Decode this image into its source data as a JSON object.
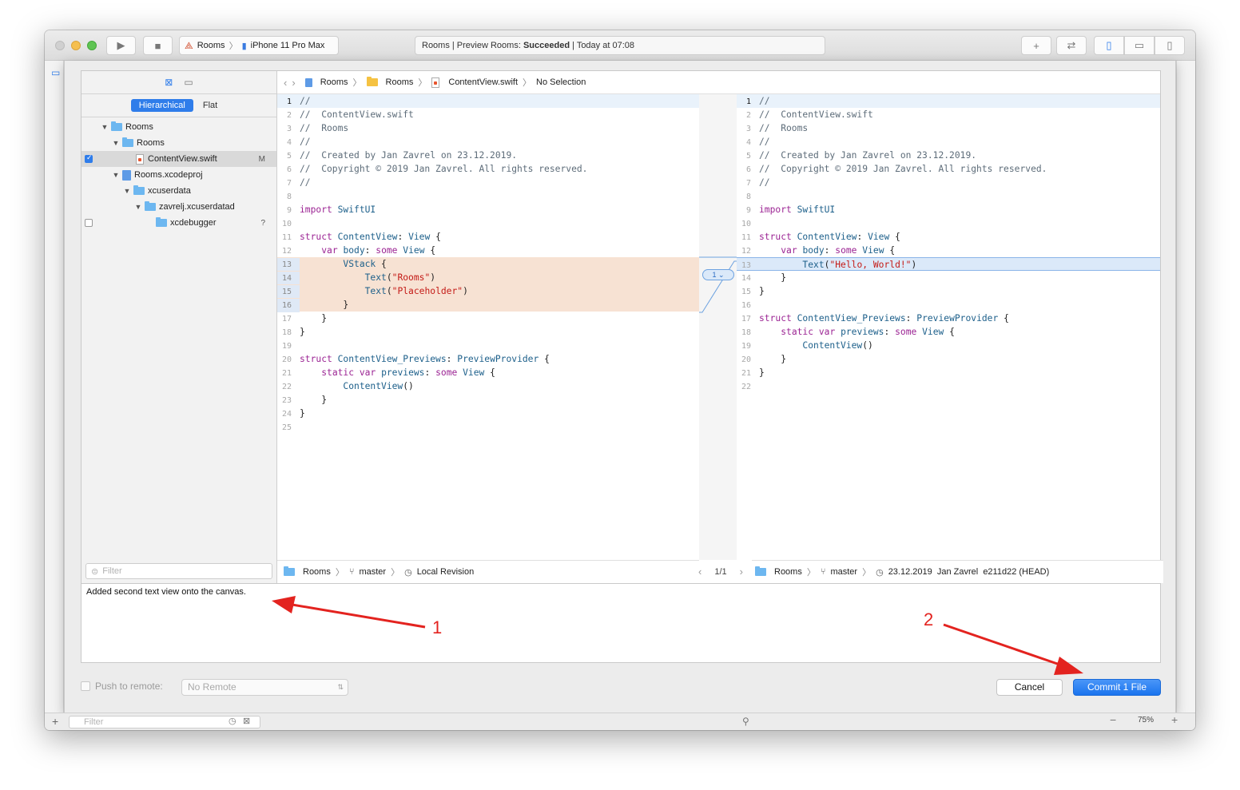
{
  "toolbar": {
    "scheme_project": "Rooms",
    "scheme_device": "iPhone 11 Pro Max",
    "status_prefix": "Rooms | Preview Rooms: ",
    "status_result": "Succeeded",
    "status_suffix": " | Today at 07:08"
  },
  "navigator": {
    "mode_hierarchical": "Hierarchical",
    "mode_flat": "Flat",
    "tree": [
      {
        "label": "Rooms",
        "type": "project",
        "checked": null,
        "flag": ""
      },
      {
        "label": "Rooms",
        "type": "folder",
        "checked": null,
        "flag": ""
      },
      {
        "label": "ContentView.swift",
        "type": "file",
        "checked": true,
        "flag": "M"
      },
      {
        "label": "Rooms.xcodeproj",
        "type": "project",
        "checked": null,
        "flag": ""
      },
      {
        "label": "xcuserdata",
        "type": "folder",
        "checked": null,
        "flag": ""
      },
      {
        "label": "zavrelj.xcuserdatad",
        "type": "folder",
        "checked": null,
        "flag": ""
      },
      {
        "label": "xcdebugger",
        "type": "folder",
        "checked": false,
        "flag": "?"
      }
    ],
    "filter_placeholder": "Filter"
  },
  "jumpbar": {
    "crumbs": [
      "Rooms",
      "Rooms",
      "ContentView.swift",
      "No Selection"
    ]
  },
  "left_code": [
    {
      "n": "1",
      "text": "//"
    },
    {
      "n": "2",
      "text": "//  ContentView.swift"
    },
    {
      "n": "3",
      "text": "//  Rooms"
    },
    {
      "n": "4",
      "text": "//"
    },
    {
      "n": "5",
      "text": "//  Created by Jan Zavrel on 23.12.2019."
    },
    {
      "n": "6",
      "text": "//  Copyright © 2019 Jan Zavrel. All rights reserved."
    },
    {
      "n": "7",
      "text": "//"
    },
    {
      "n": "8",
      "text": ""
    },
    {
      "n": "9",
      "text": "import SwiftUI"
    },
    {
      "n": "10",
      "text": ""
    },
    {
      "n": "11",
      "text": "struct ContentView: View {"
    },
    {
      "n": "12",
      "text": "    var body: some View {"
    },
    {
      "n": "13",
      "text": "        VStack {"
    },
    {
      "n": "14",
      "text": "            Text(\"Rooms\")"
    },
    {
      "n": "15",
      "text": "            Text(\"Placeholder\")"
    },
    {
      "n": "16",
      "text": "        }"
    },
    {
      "n": "17",
      "text": "    }"
    },
    {
      "n": "18",
      "text": "}"
    },
    {
      "n": "19",
      "text": ""
    },
    {
      "n": "20",
      "text": "struct ContentView_Previews: PreviewProvider {"
    },
    {
      "n": "21",
      "text": "    static var previews: some View {"
    },
    {
      "n": "22",
      "text": "        ContentView()"
    },
    {
      "n": "23",
      "text": "    }"
    },
    {
      "n": "24",
      "text": "}"
    },
    {
      "n": "25",
      "text": ""
    }
  ],
  "right_code": [
    {
      "n": "1",
      "text": "//"
    },
    {
      "n": "2",
      "text": "//  ContentView.swift"
    },
    {
      "n": "3",
      "text": "//  Rooms"
    },
    {
      "n": "4",
      "text": "//"
    },
    {
      "n": "5",
      "text": "//  Created by Jan Zavrel on 23.12.2019."
    },
    {
      "n": "6",
      "text": "//  Copyright © 2019 Jan Zavrel. All rights reserved."
    },
    {
      "n": "7",
      "text": "//"
    },
    {
      "n": "8",
      "text": ""
    },
    {
      "n": "9",
      "text": "import SwiftUI"
    },
    {
      "n": "10",
      "text": ""
    },
    {
      "n": "11",
      "text": "struct ContentView: View {"
    },
    {
      "n": "12",
      "text": "    var body: some View {"
    },
    {
      "n": "13",
      "text": "        Text(\"Hello, World!\")"
    },
    {
      "n": "14",
      "text": "    }"
    },
    {
      "n": "15",
      "text": "}"
    },
    {
      "n": "16",
      "text": ""
    },
    {
      "n": "17",
      "text": "struct ContentView_Previews: PreviewProvider {"
    },
    {
      "n": "18",
      "text": "    static var previews: some View {"
    },
    {
      "n": "19",
      "text": "        ContentView()"
    },
    {
      "n": "20",
      "text": "    }"
    },
    {
      "n": "21",
      "text": "}"
    },
    {
      "n": "22",
      "text": ""
    }
  ],
  "change_badge": "1",
  "footer_left": {
    "repo": "Rooms",
    "branch": "master",
    "revision": "Local Revision"
  },
  "footer_mid": {
    "counter": "1/1"
  },
  "footer_right": {
    "repo": "Rooms",
    "branch": "master",
    "revision": "23.12.2019  Jan Zavrel  e211d22 (HEAD)"
  },
  "commit_message": "Added second text view onto the canvas.",
  "push_label": "Push to remote:",
  "remote_value": "No Remote",
  "cancel_label": "Cancel",
  "commit_label": "Commit 1 File",
  "bottom": {
    "filter_placeholder": "Filter",
    "zoom": "75%"
  },
  "annotations": {
    "one": "1",
    "two": "2"
  },
  "colors": {
    "accent": "#2f7dea",
    "arrow": "#e3231f",
    "deleted_bg": "#f7e2d3",
    "added_bg": "#dbe9f9"
  }
}
